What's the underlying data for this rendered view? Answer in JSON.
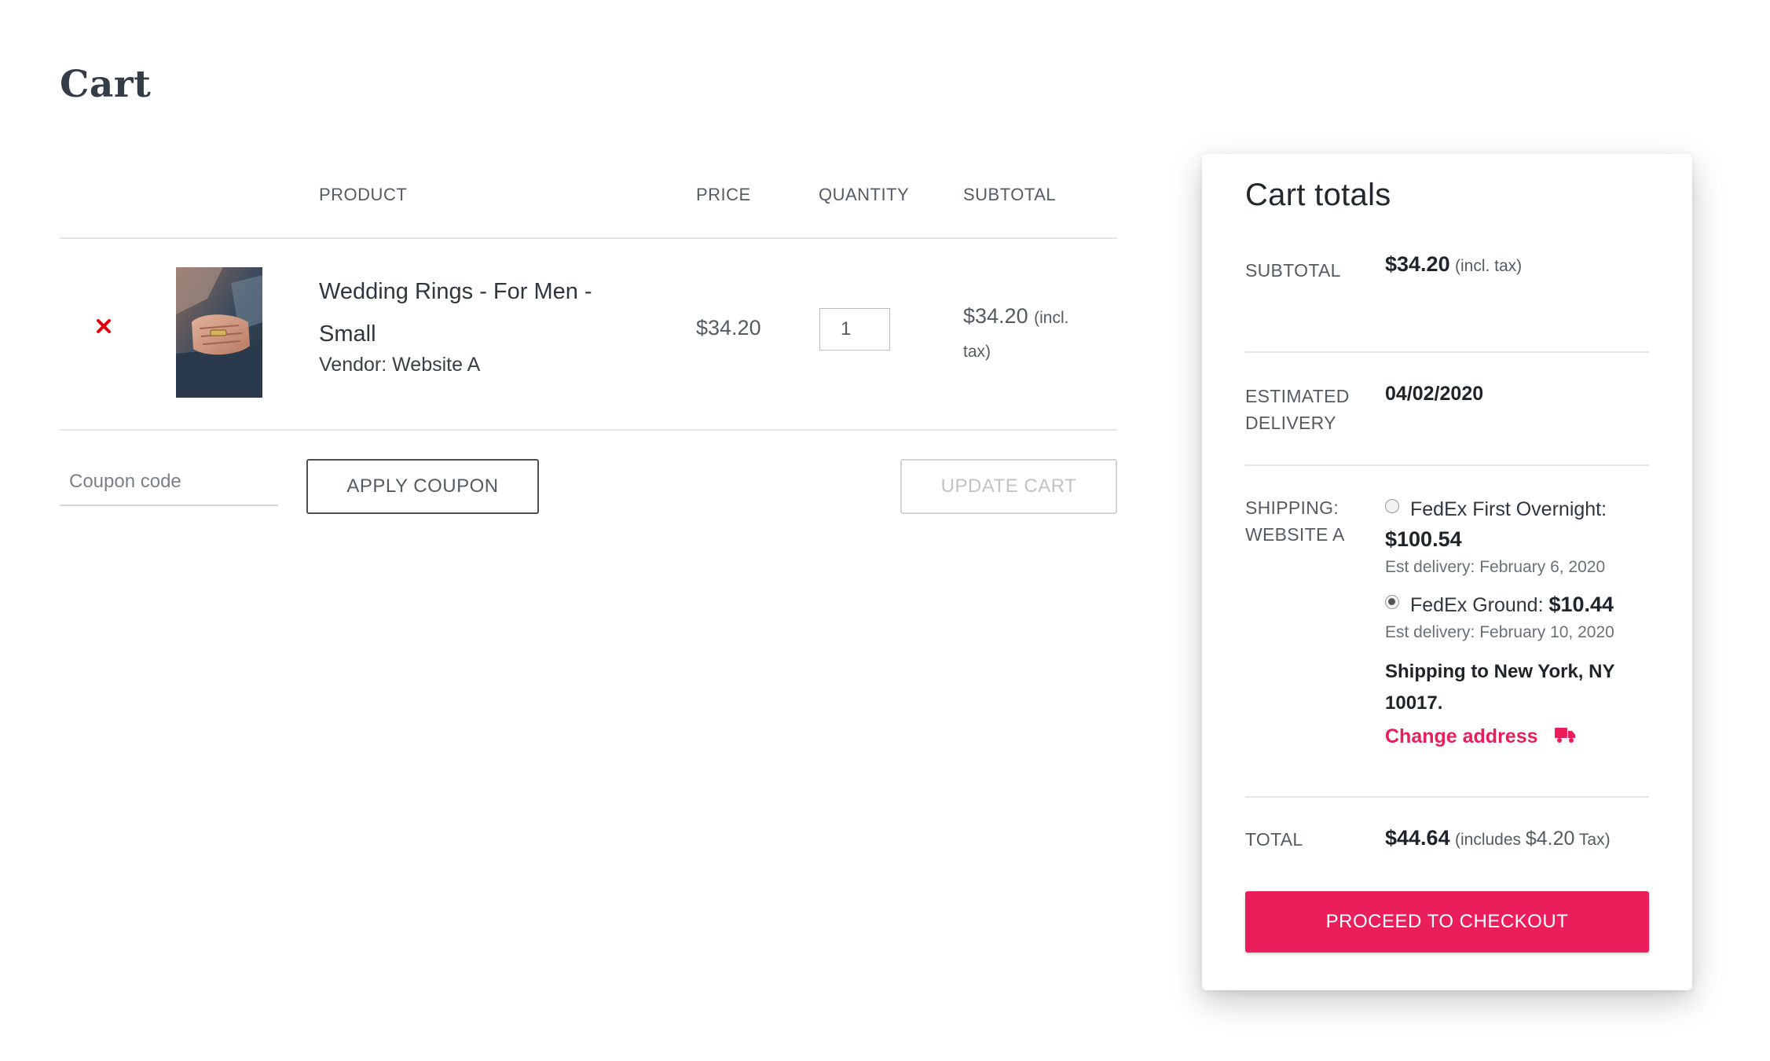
{
  "page": {
    "title": "Cart"
  },
  "table": {
    "headers": {
      "product": "PRODUCT",
      "price": "PRICE",
      "quantity": "QUANTITY",
      "subtotal": "SUBTOTAL"
    },
    "items": [
      {
        "name": "Wedding Rings - For Men - Small",
        "vendor_label": "Vendor:",
        "vendor": "Website A",
        "price": "$34.20",
        "quantity": "1",
        "subtotal": "$34.20",
        "subtotal_note": "(incl. tax)",
        "remove_icon": "close-icon",
        "remove_color": "#e3000f"
      }
    ]
  },
  "actions": {
    "coupon_placeholder": "Coupon code",
    "apply_label": "APPLY COUPON",
    "update_label": "UPDATE CART"
  },
  "totals": {
    "title": "Cart totals",
    "subtotal_label": "SUBTOTAL",
    "subtotal_value": "$34.20",
    "subtotal_note": "(incl. tax)",
    "delivery_label": "ESTIMATED DELIVERY",
    "delivery_value": "04/02/2020",
    "shipping_label": "SHIPPING: WEBSITE A",
    "shipping_options": [
      {
        "name": "FedEx First Overnight:",
        "price": "$100.54",
        "est": "Est delivery: February 6, 2020",
        "selected": false
      },
      {
        "name": "FedEx Ground:",
        "price": "$10.44",
        "est": "Est delivery: February 10, 2020",
        "selected": true
      }
    ],
    "shipping_to": "Shipping to New York, NY 10017.",
    "change_address_label": "Change address",
    "change_address_icon": "truck-icon",
    "total_label": "TOTAL",
    "total_value": "$44.64",
    "total_note_prefix": "(includes",
    "total_tax": "$4.20",
    "total_note_suffix": "Tax)",
    "checkout_label": "PROCEED TO CHECKOUT"
  },
  "colors": {
    "accent": "#e91e5a",
    "remove": "#e3000f",
    "text": "#3a3f47"
  }
}
